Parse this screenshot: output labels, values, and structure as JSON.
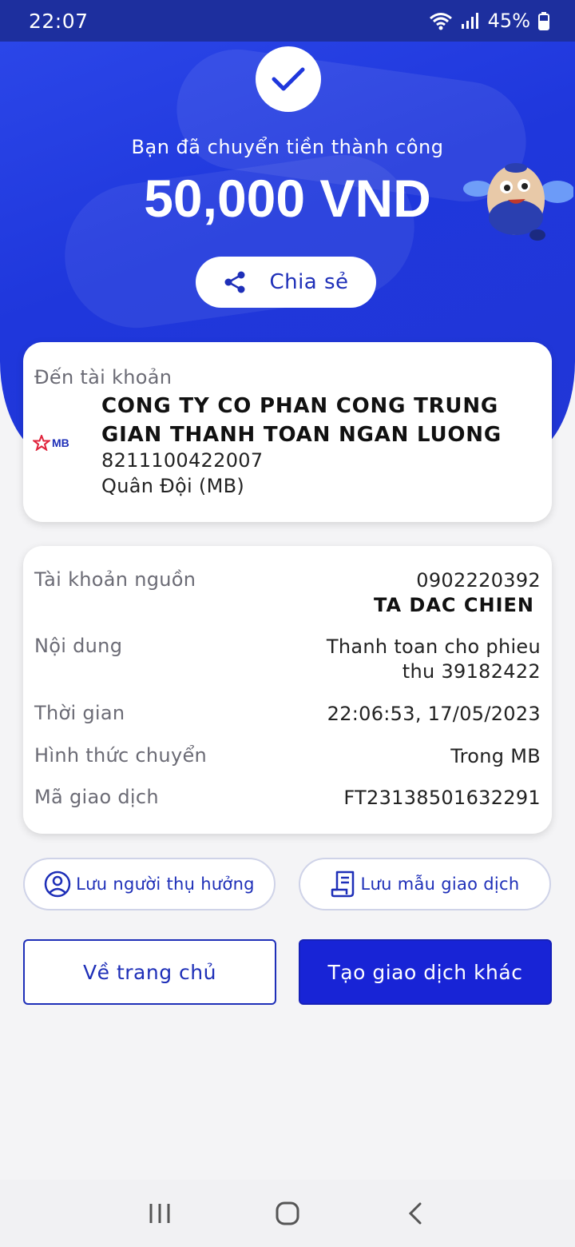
{
  "status_bar": {
    "time": "22:07",
    "battery": "45%"
  },
  "hero": {
    "message": "Bạn đã chuyển tiền thành công",
    "amount": "50,000 VND",
    "share_label": "Chia sẻ"
  },
  "recipient": {
    "label": "Đến tài khoản",
    "bank_logo_text": "MB",
    "name_line1": "CONG TY CO PHAN CONG TRUNG",
    "name_line2": "GIAN THANH TOAN NGAN LUONG",
    "account_number": "8211100422007",
    "bank_name": "Quân Đội (MB)"
  },
  "details": {
    "source_label": "Tài khoản nguồn",
    "source_account": "0902220392",
    "source_name": "TA DAC CHIEN",
    "content_label": "Nội dung",
    "content_line1": "Thanh toan cho phieu",
    "content_line2": "thu 39182422",
    "time_label": "Thời gian",
    "time_value": "22:06:53, 17/05/2023",
    "method_label": "Hình thức chuyển",
    "method_value": "Trong MB",
    "txn_label": "Mã giao dịch",
    "txn_value": "FT23138501632291"
  },
  "actions": {
    "save_beneficiary": "Lưu người thụ hưởng",
    "save_template": "Lưu mẫu giao dịch",
    "home": "Về trang chủ",
    "new_transaction": "Tạo giao dịch khác"
  },
  "icons": {
    "check": "check-icon",
    "share": "share-icon",
    "user": "user-circle-icon",
    "template": "receipt-icon",
    "nav_recent": "recent-apps-icon",
    "nav_home": "home-icon",
    "nav_back": "back-icon"
  },
  "colors": {
    "brand_blue": "#1f37dc",
    "primary_button": "#1824d6",
    "accent_text": "#1e2fb8"
  }
}
